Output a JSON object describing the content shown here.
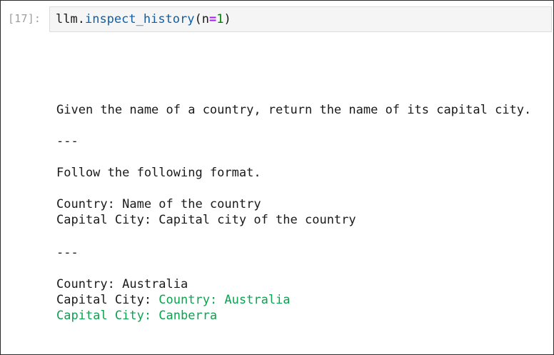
{
  "cell": {
    "prompt": "[17]:",
    "code": {
      "object": "llm",
      "dot": ".",
      "method": "inspect_history",
      "open_paren": "(",
      "arg_name": "n",
      "equals": "=",
      "arg_value": "1",
      "close_paren": ")"
    }
  },
  "output": {
    "instruction": "Given the name of a country, return the name of its capital city.",
    "separator_1": "---",
    "format_intro": "Follow the following format.",
    "format_country": "Country: Name of the country",
    "format_capital": "Capital City: Capital city of the country",
    "separator_2": "---",
    "example_country": "Country: Australia",
    "example_capital_label": "Capital City: ",
    "completion_line_1": "Country: Australia",
    "completion_line_2": "Capital City: Canberra"
  },
  "colors": {
    "completion": "#0aa34f",
    "method": "#0f5fa6",
    "operator": "#a020f0",
    "number": "#008000",
    "prompt": "#9e9e9e"
  }
}
